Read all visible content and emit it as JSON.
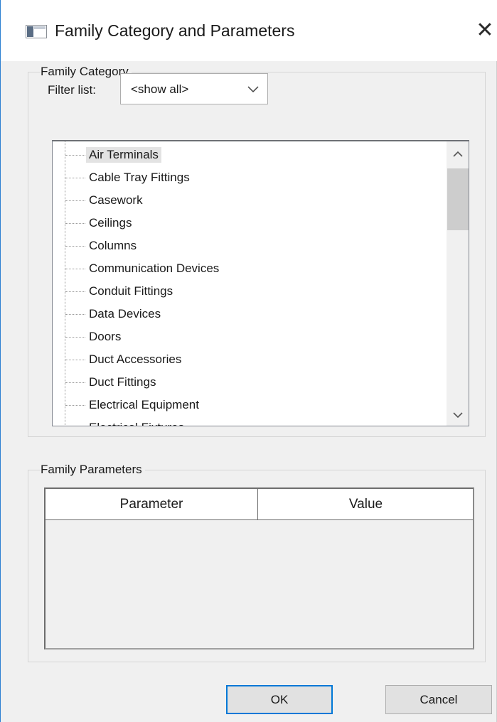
{
  "window": {
    "title": "Family Category and Parameters",
    "close_glyph": "✕",
    "accent_color": "#0078d7"
  },
  "family_category": {
    "group_label": "Family Category",
    "filter": {
      "label": "Filter list:",
      "selected_value": "<show all>"
    },
    "list": {
      "items": [
        "Air Terminals",
        "Cable Tray Fittings",
        "Casework",
        "Ceilings",
        "Columns",
        "Communication Devices",
        "Conduit Fittings",
        "Data Devices",
        "Doors",
        "Duct Accessories",
        "Duct Fittings",
        "Electrical Equipment",
        "Electrical Fixtures"
      ],
      "selected_index": 0
    }
  },
  "family_parameters": {
    "group_label": "Family Parameters",
    "columns": [
      "Parameter",
      "Value"
    ],
    "rows": []
  },
  "buttons": {
    "ok_label": "OK",
    "cancel_label": "Cancel"
  },
  "icons": [
    "app-icon",
    "close-icon",
    "chevron-down-icon",
    "scroll-up-icon",
    "scroll-down-icon"
  ]
}
